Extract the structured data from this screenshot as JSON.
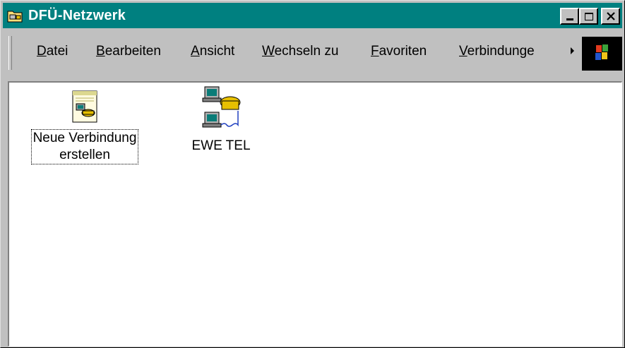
{
  "window": {
    "title": "DFÜ-Netzwerk"
  },
  "menu": [
    {
      "accel": "D",
      "rest": "atei"
    },
    {
      "accel": "B",
      "rest": "earbeiten"
    },
    {
      "accel": "A",
      "rest": "nsicht"
    },
    {
      "accel": "W",
      "rest": "echseln zu"
    },
    {
      "accel": "F",
      "rest": "avoriten"
    },
    {
      "accel": "V",
      "rest": "erbindunge"
    }
  ],
  "items": [
    {
      "label_line1": "Neue Verbindung",
      "label_line2": "erstellen",
      "icon": "new-connection-icon"
    },
    {
      "label_line1": "EWE TEL",
      "icon": "dialup-connection-icon"
    }
  ],
  "colors": {
    "titlebar": "#008080",
    "face": "#c0c0c0",
    "content_bg": "#ffffff"
  }
}
